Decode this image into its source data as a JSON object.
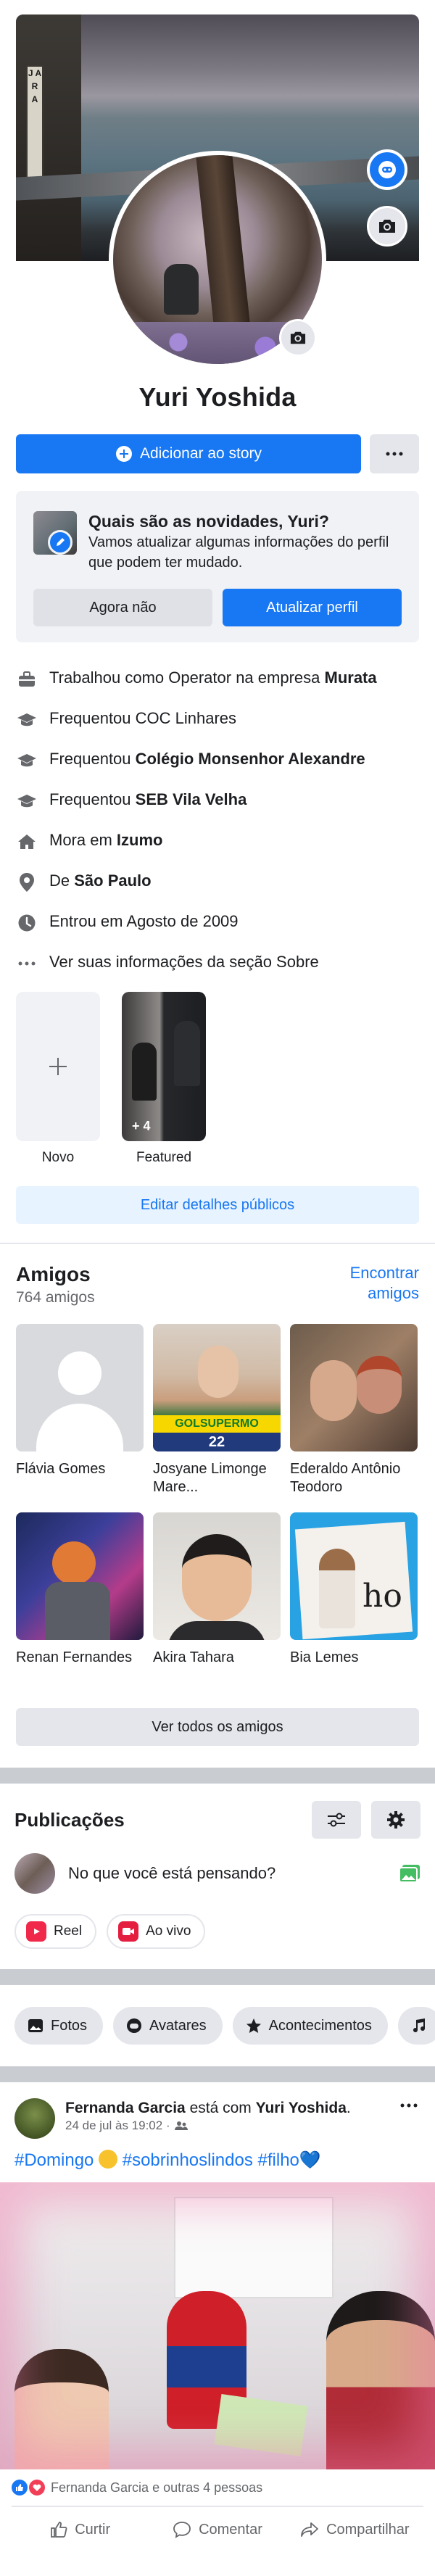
{
  "profile": {
    "name": "Yuri Yoshida",
    "cover_sign_text": "J A R A",
    "add_story_label": "Adicionar ao story",
    "more_label": "···"
  },
  "update_card": {
    "title": "Quais são as novidades, Yuri?",
    "text": "Vamos atualizar algumas informações do perfil que podem ter mudado.",
    "not_now_label": "Agora não",
    "update_label": "Atualizar perfil"
  },
  "details": [
    {
      "icon": "briefcase-icon",
      "prefix": "Trabalhou como Operator na empresa ",
      "bold": "Murata"
    },
    {
      "icon": "graduation-cap-icon",
      "prefix": "Frequentou COC Linhares",
      "bold": ""
    },
    {
      "icon": "graduation-cap-icon",
      "prefix": "Frequentou ",
      "bold": "Colégio Monsenhor Alexandre"
    },
    {
      "icon": "graduation-cap-icon",
      "prefix": "Frequentou ",
      "bold": "SEB Vila Velha"
    },
    {
      "icon": "home-icon",
      "prefix": "Mora em ",
      "bold": "Izumo"
    },
    {
      "icon": "location-pin-icon",
      "prefix": "De ",
      "bold": "São Paulo"
    },
    {
      "icon": "clock-icon",
      "prefix": "Entrou em Agosto de 2009",
      "bold": ""
    },
    {
      "icon": "ellipsis-icon",
      "prefix": "Ver suas informações da seção Sobre",
      "bold": ""
    }
  ],
  "highlights": {
    "new_label": "Novo",
    "featured_label": "Featured",
    "featured_count": "+ 4"
  },
  "edit_public_label": "Editar detalhes públicos",
  "friends": {
    "title": "Amigos",
    "count": "764 amigos",
    "find_label_1": "Encontrar",
    "find_label_2": "amigos",
    "items": [
      {
        "name": "Flávia Gomes"
      },
      {
        "name": "Josyane Limonge Mare..."
      },
      {
        "name": "Ederaldo Antônio Teodoro"
      },
      {
        "name": "Renan Fernandes"
      },
      {
        "name": "Akira Tahara"
      },
      {
        "name": "Bia Lemes"
      }
    ],
    "josy_badge": "GOLSUPERMO",
    "josy_number": "22",
    "bia_text": "ho",
    "see_all_label": "Ver todos os amigos"
  },
  "posts": {
    "title": "Publicações",
    "composer_placeholder": "No que você está pensando?",
    "reel_label": "Reel",
    "live_label": "Ao vivo"
  },
  "filters": [
    "Fotos",
    "Avatares",
    "Acontecimentos"
  ],
  "post": {
    "author": "Fernanda Garcia",
    "with_text": " está com ",
    "tagged": "Yuri Yoshida",
    "end_dot": ".",
    "date": "24 de jul às 19:02 · ",
    "text_1": "#Domingo ",
    "text_2": " #sobrinhoslindos #filho",
    "text_heart": "💙",
    "reactions_text": "Fernanda Garcia e outras 4 pessoas",
    "like_label": "Curtir",
    "comment_label": "Comentar",
    "share_label": "Compartilhar"
  },
  "colors": {
    "accent": "#1877f2",
    "light_accent": "#e7f3ff",
    "button_grey": "#e4e6eb",
    "separator": "#c9ccd1",
    "reel_icon": "#f02849",
    "live_icon": "#e41e3f",
    "photo_icon": "#45bd62"
  }
}
